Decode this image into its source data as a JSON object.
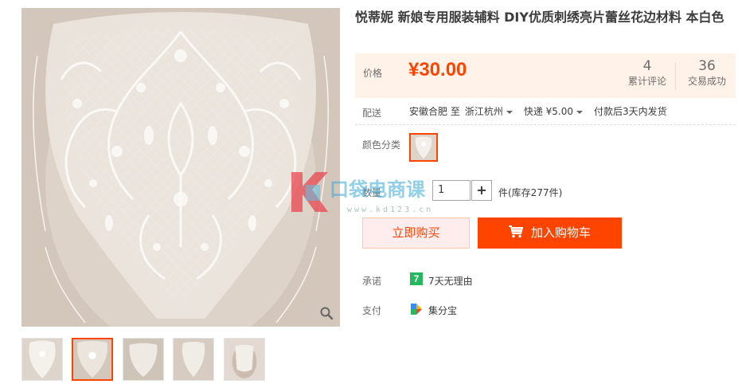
{
  "product": {
    "title": "悦蒂妮 新娘专用服装辅料 DIY优质刺绣亮片蕾丝花边材料 本白色"
  },
  "price": {
    "label": "价格",
    "value": "¥30.00"
  },
  "stats": [
    {
      "num": "4",
      "label": "累计评论"
    },
    {
      "num": "36",
      "label": "交易成功"
    }
  ],
  "delivery": {
    "label": "配送",
    "from": "安徽合肥 至",
    "to": "浙江杭州",
    "shipping": "快递 ¥5.00",
    "ship_time": "付款后3天内发货"
  },
  "color": {
    "label": "颜色分类"
  },
  "quantity": {
    "label": "数量",
    "value": "1",
    "plus": "+",
    "stock": "件(库存277件)"
  },
  "actions": {
    "buy_now": "立即购买",
    "add_to_cart": "加入购物车"
  },
  "promise": {
    "label": "承诺",
    "icon_text": "7",
    "text": "7天无理由"
  },
  "payment": {
    "label": "支付",
    "text": "集分宝"
  },
  "watermark": {
    "brand": "口袋电商课",
    "url": "www.kd123.cn"
  },
  "colors": {
    "accent": "#ff4400",
    "price_bg": "#fff2e8",
    "promise_green": "#26b85e"
  },
  "icons": {
    "zoom": "magnifier-icon",
    "cart": "cart-icon",
    "payment": "jifenbao-icon"
  }
}
